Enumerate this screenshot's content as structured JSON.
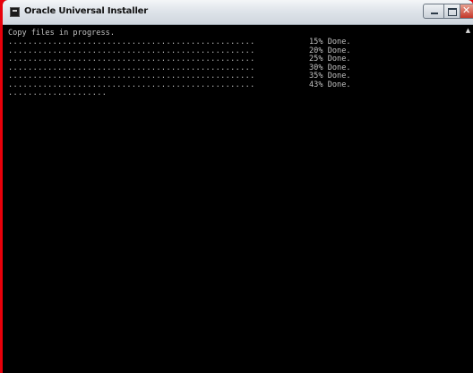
{
  "window": {
    "title": "Oracle Universal Installer",
    "icon": "console-icon",
    "controls": {
      "minimize": "minimize-icon",
      "maximize": "maximize-icon",
      "close": "close-icon"
    }
  },
  "console": {
    "header": "Copy files in progress.",
    "progress_lines": [
      {
        "dots": "..................................................",
        "status": "15% Done."
      },
      {
        "dots": "..................................................",
        "status": "20% Done."
      },
      {
        "dots": "..................................................",
        "status": "25% Done."
      },
      {
        "dots": "..................................................",
        "status": "30% Done."
      },
      {
        "dots": "..................................................",
        "status": "35% Done."
      },
      {
        "dots": "..................................................",
        "status": "43% Done."
      }
    ],
    "partial_line": "...................."
  },
  "scrollbar": {
    "up_arrow": "scroll-up-arrow-icon"
  }
}
